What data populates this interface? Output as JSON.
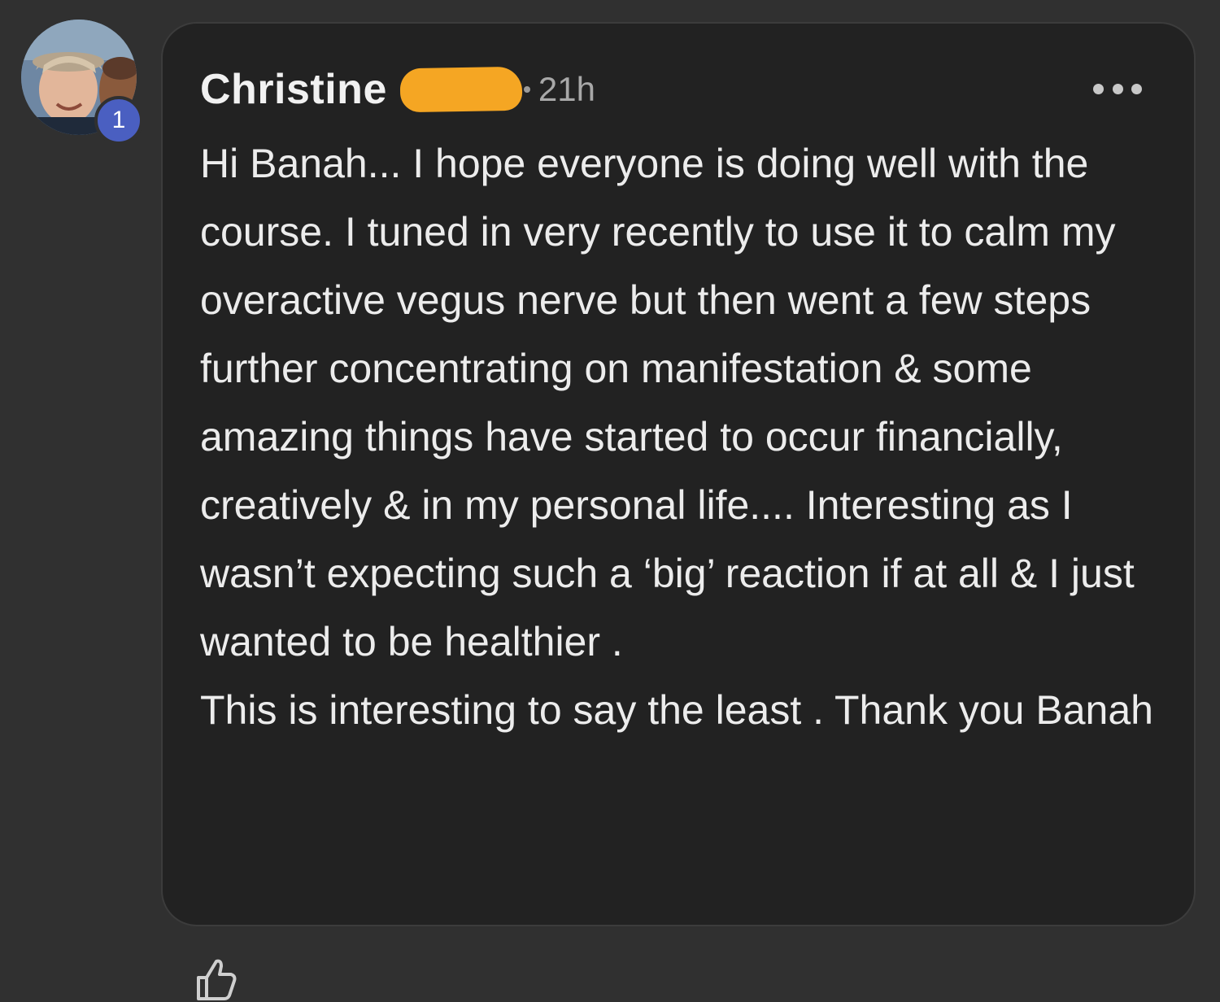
{
  "comment": {
    "author": "Christine",
    "level": "1",
    "separator": "•",
    "time": "21h",
    "paragraphs": [
      "Hi Banah... I hope everyone is doing well with the course. I tuned in very recently to use it to calm my overactive vegus nerve but then went a few steps further concentrating on manifestation & some amazing things have started to occur financially, creatively & in my personal life.... Interesting as I wasn’t expecting such a ‘big’ reaction if at all & I just wanted to be healthier .",
      "This is interesting to say the least . Thank you Banah"
    ]
  },
  "icons": {
    "avatar": "profile-photo",
    "more": "more-horizontal-icon",
    "like": "thumbs-up-icon"
  },
  "colors": {
    "page_background": "#303030",
    "card_background": "#222222",
    "badge": "#4a5fc1",
    "redaction": "#f5a623"
  }
}
